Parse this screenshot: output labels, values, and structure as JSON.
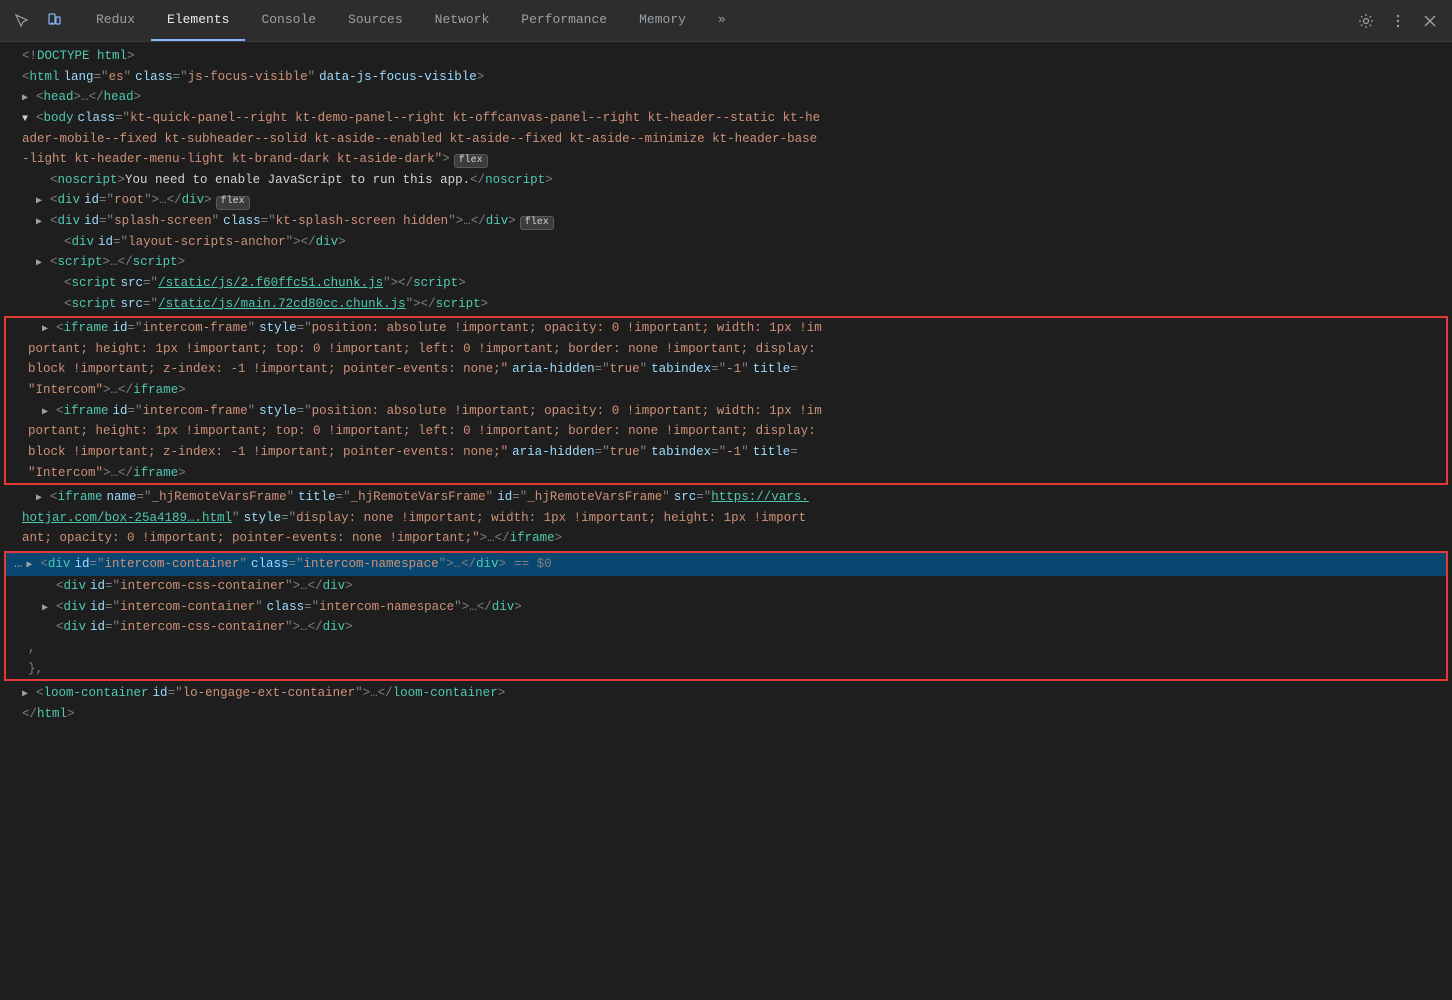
{
  "toolbar": {
    "tabs": [
      {
        "id": "redux",
        "label": "Redux",
        "active": false
      },
      {
        "id": "elements",
        "label": "Elements",
        "active": true
      },
      {
        "id": "console",
        "label": "Console",
        "active": false
      },
      {
        "id": "sources",
        "label": "Sources",
        "active": false
      },
      {
        "id": "network",
        "label": "Network",
        "active": false
      },
      {
        "id": "performance",
        "label": "Performance",
        "active": false
      },
      {
        "id": "memory",
        "label": "Memory",
        "active": false
      },
      {
        "id": "more",
        "label": "»",
        "active": false
      }
    ],
    "settings_label": "⚙",
    "more_label": "⋮",
    "close_label": "✕"
  },
  "content": {
    "lines": [
      {
        "id": 1,
        "indent": 0,
        "html": "doctype"
      },
      {
        "id": 2,
        "indent": 0,
        "html": "html-open"
      },
      {
        "id": 3,
        "indent": 0,
        "html": "head"
      },
      {
        "id": 4,
        "indent": 0,
        "html": "body-open"
      },
      {
        "id": 5,
        "indent": 1,
        "html": "noscript"
      },
      {
        "id": 6,
        "indent": 1,
        "html": "div-root"
      },
      {
        "id": 7,
        "indent": 1,
        "html": "div-splash"
      },
      {
        "id": 8,
        "indent": 2,
        "html": "div-layout"
      },
      {
        "id": 9,
        "indent": 1,
        "html": "script1"
      },
      {
        "id": 10,
        "indent": 2,
        "html": "script2"
      },
      {
        "id": 11,
        "indent": 2,
        "html": "script3"
      }
    ],
    "iframe1_line1": "▶ <iframe id=\"intercom-frame\" style=\"position: absolute !important; opacity: 0 !important; width: 1px !im",
    "iframe1_line2": "portant; height: 1px !important; top: 0 !important; left: 0 !important; border: none !important; display:",
    "iframe1_line3": "block !important; z-index: -1 !important; pointer-events: none;\" aria-hidden=\"true\" tabindex=\"-1\" title=",
    "iframe1_line4": "\"Intercom\">…</iframe>",
    "iframe2_line1": "▶ <iframe id=\"intercom-frame\" style=\"position: absolute !important; opacity: 0 !important; width: 1px !im",
    "iframe2_line2": "portant; height: 1px !important; top: 0 !important; left: 0 !important; border: none !important; display:",
    "iframe2_line3": "block !important; z-index: -1 !important; pointer-events: none;\" aria-hidden=\"true\" tabindex=\"-1\" title=",
    "iframe2_line4": "\"Intercom\">…</iframe>",
    "njframe_line1": "▶ <iframe name=\"_hjRemoteVarsFrame\" title=\"_hjRemoteVarsFrame\" id=\"_hjRemoteVarsFrame\" src=\"https://vars.",
    "njframe_line2": "hotjar.com/box-25a4189….html\" style=\"display: none !important; width: 1px !important; height: 1px !import",
    "njframe_line3": "ant; opacity: 0 !important; pointer-events: none !important;\">…</iframe>",
    "intercom_div1": "▶ <div id=\"intercom-container\" class=\"intercom-namespace\">…</div>",
    "intercom_div2": "<div id=\"intercom-css-container\">…</div>",
    "intercom_div3": "▶ <div id=\"intercom-container\" class=\"intercom-namespace\">…</div>",
    "intercom_div4": "<div id=\"intercom-css-container\">…</div>",
    "loom_line": "▶ <loom-container id=\"lo-engage-ext-container\">…</loom-container>",
    "html_close": "</html>"
  }
}
